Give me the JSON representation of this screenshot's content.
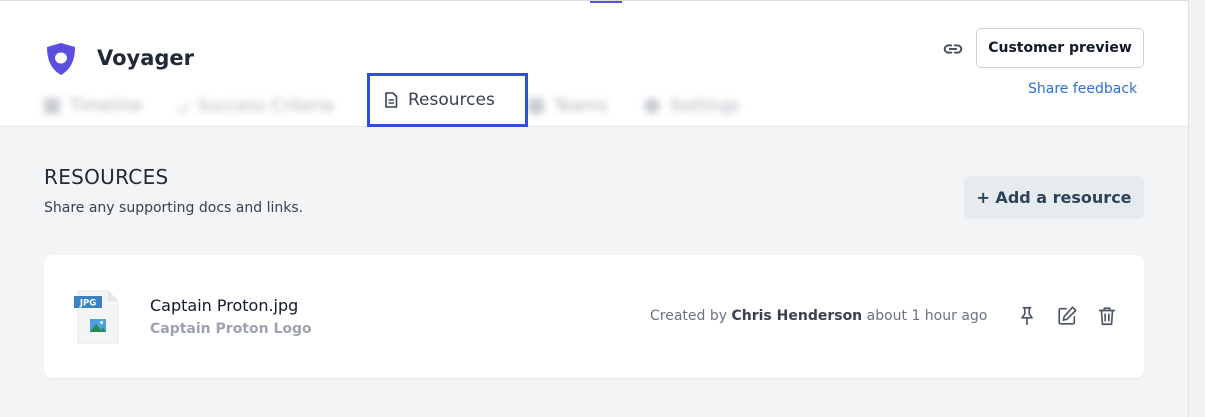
{
  "app": {
    "title": "Voyager"
  },
  "tabs": [
    {
      "label": "Timeline"
    },
    {
      "label": "Success Criteria"
    },
    {
      "label": "Resources"
    },
    {
      "label": "Teams"
    },
    {
      "label": "Settings"
    }
  ],
  "header": {
    "customer_preview_label": "Customer preview",
    "share_feedback_label": "Share feedback"
  },
  "section": {
    "title": "RESOURCES",
    "subtitle": "Share any supporting docs and links.",
    "add_button_label": "+ Add a resource"
  },
  "resource": {
    "file_badge": "JPG",
    "file_name": "Captain Proton.jpg",
    "description": "Captain Proton Logo",
    "created_prefix": "Created by",
    "author": "Chris Henderson",
    "time": "about 1 hour ago"
  },
  "colors": {
    "accent": "#2e4fd6",
    "logo": "#5b4fe0",
    "link": "#2f6fd8"
  },
  "icons": [
    "shield-logo-icon",
    "document-icon",
    "link-icon",
    "pin-icon",
    "edit-icon",
    "trash-icon",
    "jpg-file-icon"
  ]
}
